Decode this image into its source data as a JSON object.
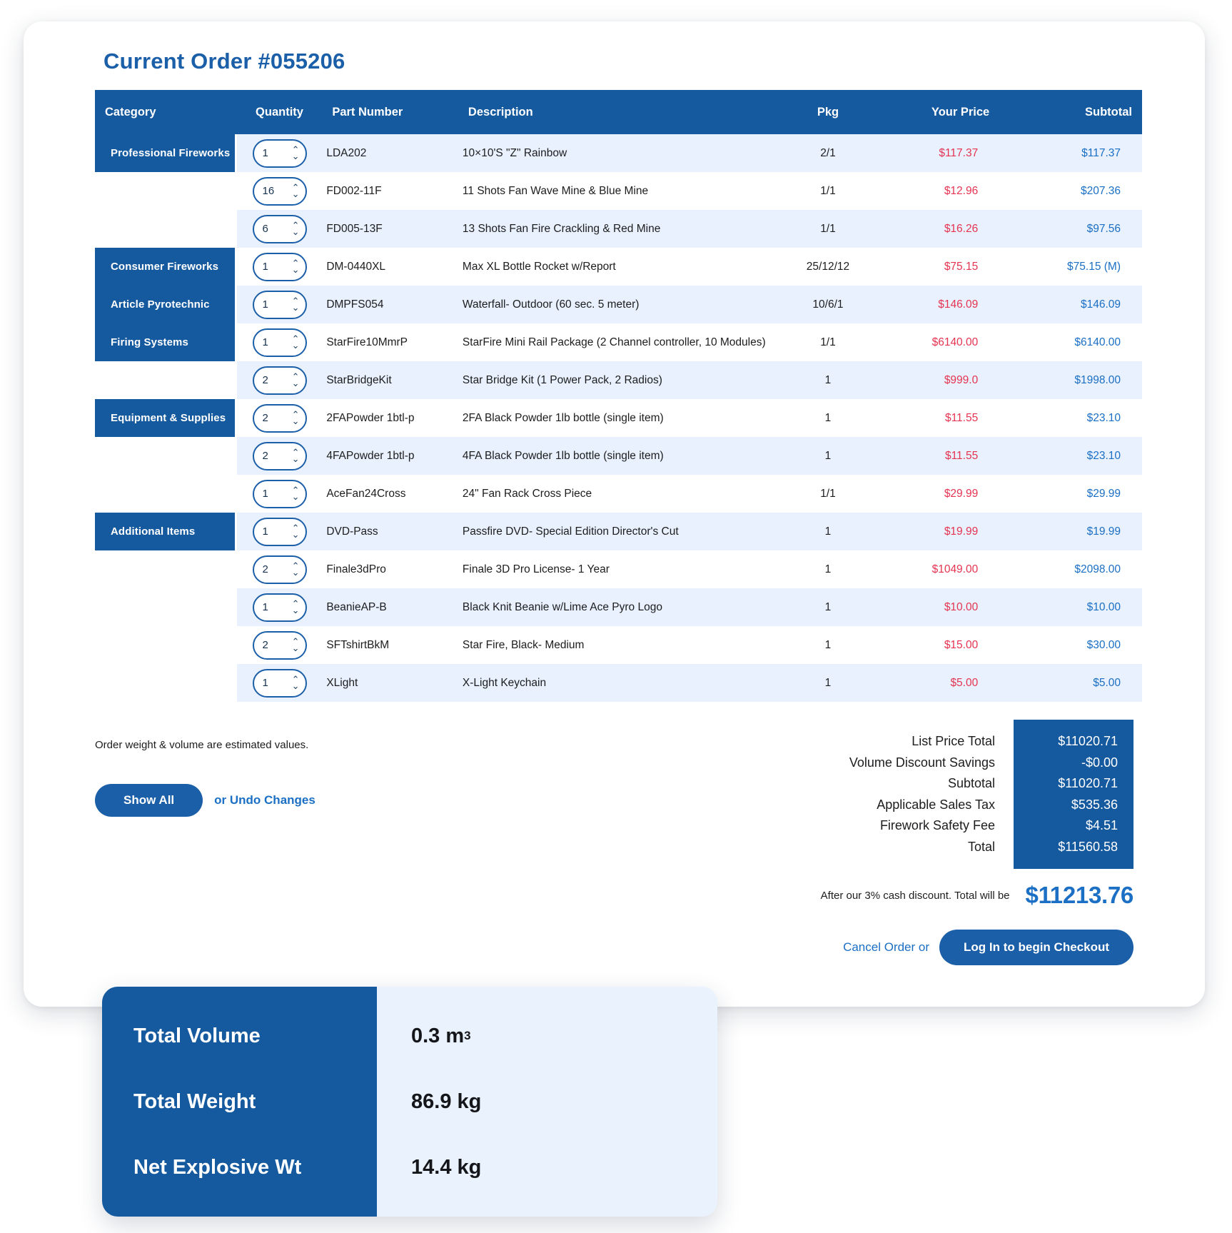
{
  "order": {
    "title": "Current Order #055206"
  },
  "table": {
    "headers": {
      "category": "Category",
      "quantity": "Quantity",
      "part_number": "Part Number",
      "description": "Description",
      "pkg": "Pkg",
      "your_price": "Your Price",
      "subtotal": "Subtotal"
    },
    "rows": [
      {
        "category": "Professional Fireworks",
        "qty": "1",
        "part": "LDA202",
        "desc": "10×10'S \"Z\" Rainbow",
        "pkg": "2/1",
        "price": "$117.37",
        "subtotal": "$117.37"
      },
      {
        "category": "",
        "qty": "16",
        "part": "FD002-11F",
        "desc": "11 Shots Fan Wave Mine & Blue Mine",
        "pkg": "1/1",
        "price": "$12.96",
        "subtotal": "$207.36"
      },
      {
        "category": "",
        "qty": "6",
        "part": "FD005-13F",
        "desc": "13 Shots Fan Fire Crackling & Red Mine",
        "pkg": "1/1",
        "price": "$16.26",
        "subtotal": "$97.56"
      },
      {
        "category": "Consumer Fireworks",
        "qty": "1",
        "part": "DM-0440XL",
        "desc": "Max XL Bottle Rocket w/Report",
        "pkg": "25/12/12",
        "price": "$75.15",
        "subtotal": "$75.15 (M)"
      },
      {
        "category": "Article Pyrotechnic",
        "qty": "1",
        "part": "DMPFS054",
        "desc": "Waterfall- Outdoor (60 sec. 5 meter)",
        "pkg": "10/6/1",
        "price": "$146.09",
        "subtotal": "$146.09"
      },
      {
        "category": "Firing Systems",
        "qty": "1",
        "part": "StarFire10MmrP",
        "desc": "StarFire Mini Rail Package (2 Channel controller, 10 Modules)",
        "pkg": "1/1",
        "price": "$6140.00",
        "subtotal": "$6140.00"
      },
      {
        "category": "",
        "qty": "2",
        "part": "StarBridgeKit",
        "desc": "Star Bridge Kit (1 Power Pack, 2 Radios)",
        "pkg": "1",
        "price": "$999.0",
        "subtotal": "$1998.00"
      },
      {
        "category": "Equipment & Supplies",
        "qty": "2",
        "part": "2FAPowder 1btl-p",
        "desc": "2FA Black Powder 1lb bottle (single item)",
        "pkg": "1",
        "price": "$11.55",
        "subtotal": "$23.10"
      },
      {
        "category": "",
        "qty": "2",
        "part": "4FAPowder 1btl-p",
        "desc": "4FA Black Powder 1lb bottle (single item)",
        "pkg": "1",
        "price": "$11.55",
        "subtotal": "$23.10"
      },
      {
        "category": "",
        "qty": "1",
        "part": "AceFan24Cross",
        "desc": "24\" Fan Rack Cross Piece",
        "pkg": "1/1",
        "price": "$29.99",
        "subtotal": "$29.99"
      },
      {
        "category": "Additional Items",
        "qty": "1",
        "part": "DVD-Pass",
        "desc": "Passfire DVD- Special Edition Director's Cut",
        "pkg": "1",
        "price": "$19.99",
        "subtotal": "$19.99"
      },
      {
        "category": "",
        "qty": "2",
        "part": "Finale3dPro",
        "desc": "Finale 3D Pro License- 1 Year",
        "pkg": "1",
        "price": "$1049.00",
        "subtotal": "$2098.00"
      },
      {
        "category": "",
        "qty": "1",
        "part": "BeanieAP-B",
        "desc": "Black Knit Beanie w/Lime Ace Pyro Logo",
        "pkg": "1",
        "price": "$10.00",
        "subtotal": "$10.00"
      },
      {
        "category": "",
        "qty": "2",
        "part": "SFTshirtBkM",
        "desc": "Star Fire, Black- Medium",
        "pkg": "1",
        "price": "$15.00",
        "subtotal": "$30.00"
      },
      {
        "category": "",
        "qty": "1",
        "part": "XLight",
        "desc": "X-Light Keychain",
        "pkg": "1",
        "price": "$5.00",
        "subtotal": "$5.00"
      }
    ]
  },
  "footer": {
    "note": "Order weight & volume are estimated values.",
    "show_all_label": "Show All",
    "undo_label": "or Undo Changes"
  },
  "totals": {
    "lines": [
      {
        "label": "List Price Total",
        "value": "$11020.71"
      },
      {
        "label": "Volume Discount Savings",
        "value": "-$0.00"
      },
      {
        "label": "Subtotal",
        "value": "$11020.71"
      },
      {
        "label": "Applicable Sales Tax",
        "value": "$535.36"
      },
      {
        "label": "Firework Safety Fee",
        "value": "$4.51"
      },
      {
        "label": "Total",
        "value": "$11560.58"
      }
    ],
    "cash_discount_text": "After our 3% cash discount. Total will be",
    "cash_discount_total": "$11213.76"
  },
  "actions": {
    "cancel_label": "Cancel Order or",
    "checkout_label": "Log In to begin Checkout"
  },
  "summary": {
    "rows": [
      {
        "label": "Total Volume",
        "value": "0.3 m",
        "sup": "3"
      },
      {
        "label": "Total Weight",
        "value": "86.9 kg",
        "sup": ""
      },
      {
        "label": "Net Explosive Wt",
        "value": "14.4 kg",
        "sup": ""
      }
    ]
  },
  "colors": {
    "brand_blue": "#15599f",
    "link_blue": "#1b6fc4",
    "price_red": "#e53451",
    "row_alt": "#e8f1fd"
  }
}
